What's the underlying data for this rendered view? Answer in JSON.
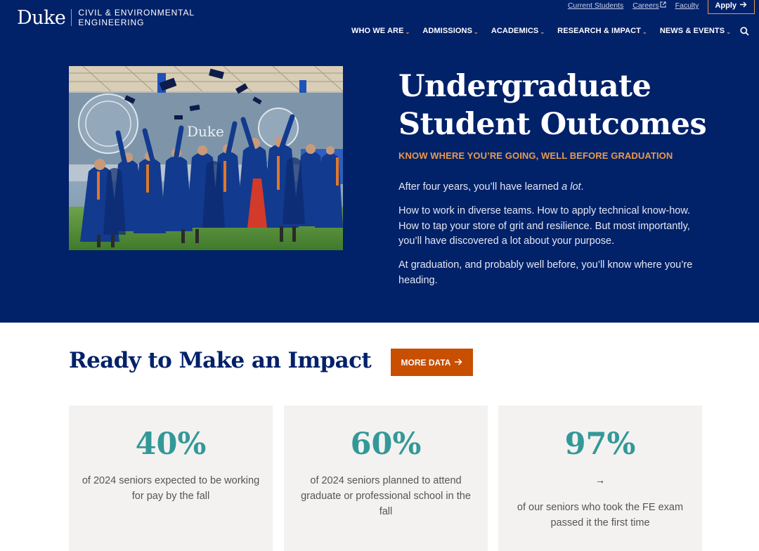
{
  "header": {
    "logo_word": "Duke",
    "dept_line1": "CIVIL & ENVIRONMENTAL",
    "dept_line2": "ENGINEERING",
    "util_links": {
      "current_students": "Current Students",
      "careers": "Careers",
      "faculty": "Faculty"
    },
    "apply_label": "Apply",
    "nav": [
      "WHO WE ARE",
      "ADMISSIONS",
      "ACADEMICS",
      "RESEARCH & IMPACT",
      "NEWS & EVENTS"
    ],
    "icons": {
      "search": "search-icon",
      "external": "external-link-icon",
      "apply_arrow": "arrow-right-icon",
      "nav_chevron": "chevron-down-icon"
    }
  },
  "hero": {
    "image_alt": "Graduates in blue gowns tossing caps at commencement",
    "title": "Undergraduate Student Outcomes",
    "kicker": "KNOW WHERE YOU’RE GOING, WELL BEFORE GRADUATION",
    "para1_pre": "After four years, you’ll have learned ",
    "para1_em": "a lot",
    "para1_post": ".",
    "para2": "How to work in diverse teams. How to apply technical know-how. How to tap your store of grit and resilience. But most importantly, you’ll have discovered a lot about your purpose.",
    "para3": "At graduation, and probably well before, you’ll know where you’re heading."
  },
  "impact": {
    "heading": "Ready to Make an Impact",
    "more_label": "MORE DATA",
    "stats": [
      {
        "value": "40%",
        "text": "of 2024 seniors expected to be working for pay by the fall"
      },
      {
        "value": "60%",
        "text": "of 2024 seniors planned to attend graduate or professional school in the fall"
      },
      {
        "value": "97%",
        "text": "of our seniors who took the FE exam passed it the first time",
        "arrow": "→"
      }
    ]
  },
  "colors": {
    "navy": "#012169",
    "orange": "#e89a4c",
    "burnt_orange": "#c84e00",
    "teal": "#339898",
    "card_bg": "#f3f2f1"
  }
}
